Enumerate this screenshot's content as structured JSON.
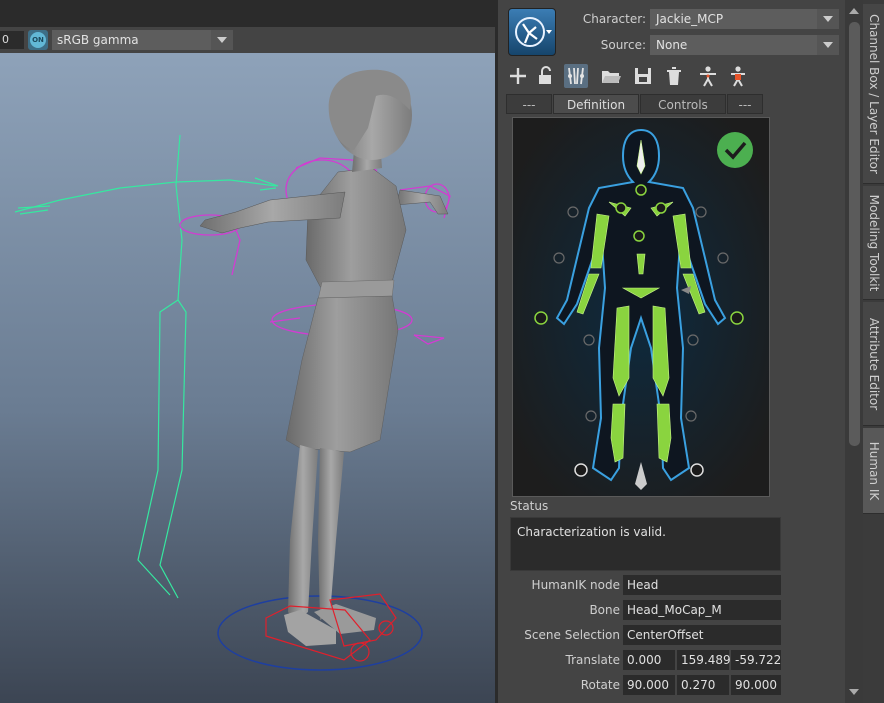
{
  "viewport": {
    "number_field": "0",
    "toggle_label": "ON",
    "color_space": "sRGB gamma"
  },
  "panel": {
    "character_label": "Character:",
    "character_value": "Jackie_MCP",
    "source_label": "Source:",
    "source_value": "None",
    "toolbar_icons": [
      "add-icon",
      "lock-icon",
      "skeleton-icon",
      "open-folder-icon",
      "save-icon",
      "delete-icon",
      "character-icon",
      "character-control-icon"
    ],
    "tabs": [
      {
        "label": "---"
      },
      {
        "label": "Definition",
        "active": true
      },
      {
        "label": "Controls"
      },
      {
        "label": "---"
      }
    ],
    "status_label": "Status",
    "status_text": "Characterization is valid.",
    "rows": {
      "humanik_node_label": "HumanIK node",
      "humanik_node_value": "Head",
      "bone_label": "Bone",
      "bone_value": "Head_MoCap_M",
      "scene_selection_label": "Scene Selection",
      "scene_selection_value": "CenterOffset",
      "translate_label": "Translate",
      "translate": [
        "0.000",
        "159.489",
        "-59.722"
      ],
      "rotate_label": "Rotate",
      "rotate": [
        "90.000",
        "0.270",
        "90.000"
      ]
    }
  },
  "side_tabs": [
    {
      "label": "Channel Box / Layer Editor"
    },
    {
      "label": "Modeling Toolkit"
    },
    {
      "label": "Attribute Editor"
    },
    {
      "label": "Human IK",
      "active": true
    }
  ],
  "colors": {
    "valid_check": "#4caf50",
    "bone_green": "#8ad43f",
    "skeleton_blue": "#3aa0e0",
    "rig_magenta": "#d23cd2",
    "joint_green": "#36e8a0"
  }
}
